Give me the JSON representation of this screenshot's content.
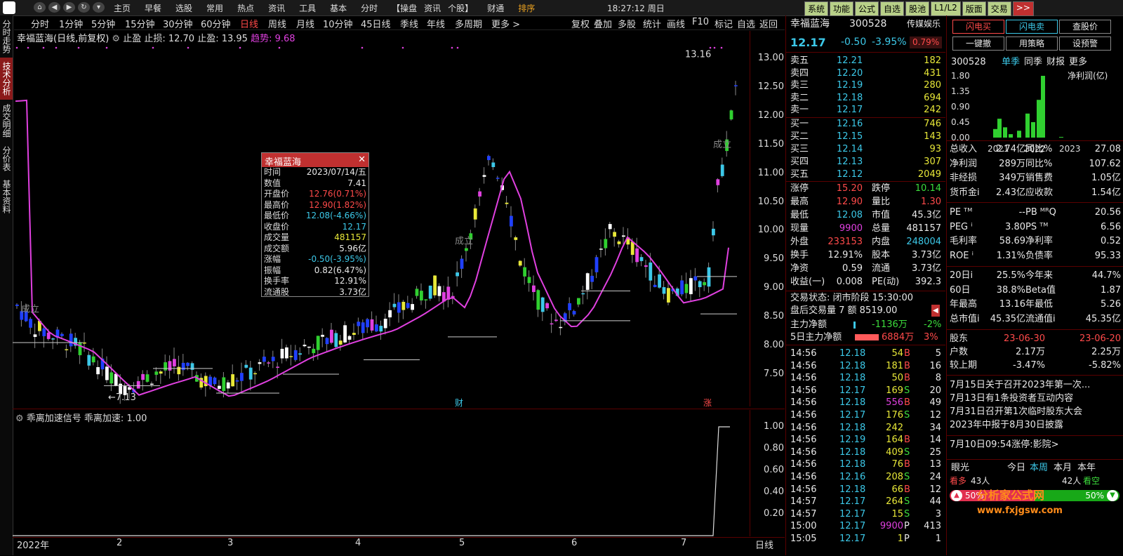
{
  "topbar": {
    "menu": [
      "主页",
      "早餐",
      "选股",
      "常用",
      "热点",
      "资讯",
      "工具",
      "基本",
      "分时",
      "【操盘",
      "资讯",
      "个股】",
      "财通",
      "排序"
    ],
    "clock": "18:27:12 周日",
    "right_buttons": [
      "系统",
      "功能",
      "公式",
      "自选",
      "股池",
      "L1/L2",
      "版面",
      "交易"
    ]
  },
  "leftrail": [
    "分时走势",
    "技术分析",
    "成交明细",
    "分价表",
    "基本资料"
  ],
  "periods": [
    "分时",
    "1分钟",
    "5分钟",
    "15分钟",
    "30分钟",
    "60分钟",
    "日线",
    "周线",
    "月线",
    "10分钟",
    "45日线",
    "季线",
    "年线",
    "多周期",
    "更多 >"
  ],
  "period_tools": [
    "复权",
    "叠加",
    "多股",
    "统计",
    "画线",
    "F10",
    "标记",
    "自选",
    "返回"
  ],
  "chart": {
    "title": "幸福蓝海(日线,前复权)",
    "stop_label": "止盈 止损: 12.70 止盈: 13.95",
    "trend_label": "趋势: 9.68",
    "price_ticks": [
      "13.00",
      "12.50",
      "12.00",
      "11.50",
      "11.00",
      "10.50",
      "10.00",
      "9.50",
      "9.00",
      "8.50",
      "8.00",
      "7.50"
    ],
    "high_label": "13.16",
    "low_label": "7.13",
    "chengli_label": "成立",
    "marker_cai": "财",
    "marker_zhang": "涨",
    "indicator_label": "乖离加速信号 乖离加速: 1.00",
    "ind_ticks": [
      "1.00",
      "0.80",
      "0.60",
      "0.40",
      "0.20"
    ],
    "x_labels": [
      "2022年",
      "2",
      "3",
      "4",
      "5",
      "6",
      "7"
    ],
    "x_period": "日线"
  },
  "popup": {
    "title": "幸福蓝海",
    "rows": [
      {
        "k": "时间",
        "v": "2023/07/14/五",
        "c": "white"
      },
      {
        "k": "数值",
        "v": "7.41",
        "c": "white"
      },
      {
        "k": "开盘价",
        "v": "12.76(0.71%)",
        "c": "red"
      },
      {
        "k": "最高价",
        "v": "12.90(1.82%)",
        "c": "red"
      },
      {
        "k": "最低价",
        "v": "12.08(-4.66%)",
        "c": "cyan"
      },
      {
        "k": "收盘价",
        "v": "12.17",
        "c": "cyan"
      },
      {
        "k": "成交量",
        "v": "481157",
        "c": "yellow"
      },
      {
        "k": "成交额",
        "v": "5.96亿",
        "c": "white"
      },
      {
        "k": "涨幅",
        "v": "-0.50(-3.95%)",
        "c": "cyan"
      },
      {
        "k": "振幅",
        "v": "0.82(6.47%)",
        "c": "white"
      },
      {
        "k": "换手率",
        "v": "12.91%",
        "c": "white"
      },
      {
        "k": "流通股",
        "v": "3.73亿",
        "c": "white"
      }
    ]
  },
  "quote": {
    "name": "幸福蓝海",
    "code": "300528",
    "sector": "传媒娱乐",
    "price": "12.17",
    "change": "-0.50",
    "pct": "-3.95%",
    "sector_pct": "0.79%",
    "asks": [
      {
        "k": "卖五",
        "p": "12.21",
        "v": "182"
      },
      {
        "k": "卖四",
        "p": "12.20",
        "v": "431"
      },
      {
        "k": "卖三",
        "p": "12.19",
        "v": "280"
      },
      {
        "k": "卖二",
        "p": "12.18",
        "v": "694"
      },
      {
        "k": "卖一",
        "p": "12.17",
        "v": "242"
      }
    ],
    "bids": [
      {
        "k": "买一",
        "p": "12.16",
        "v": "746"
      },
      {
        "k": "买二",
        "p": "12.15",
        "v": "143"
      },
      {
        "k": "买三",
        "p": "12.14",
        "v": "93"
      },
      {
        "k": "买四",
        "p": "12.13",
        "v": "307"
      },
      {
        "k": "买五",
        "p": "12.12",
        "v": "2049"
      }
    ],
    "stats": [
      {
        "k1": "涨停",
        "v1": "15.20",
        "c1": "red",
        "k2": "跌停",
        "v2": "10.14",
        "c2": "green"
      },
      {
        "k1": "最高",
        "v1": "12.90",
        "c1": "red",
        "k2": "量比",
        "v2": "1.30",
        "c2": "red"
      },
      {
        "k1": "最低",
        "v1": "12.08",
        "c1": "cyan",
        "k2": "市值",
        "v2": "45.3亿",
        "c2": "white"
      },
      {
        "k1": "现量",
        "v1": "9900",
        "c1": "mag",
        "k2": "总量",
        "v2": "481157",
        "c2": "white"
      },
      {
        "k1": "外盘",
        "v1": "233153",
        "c1": "red",
        "k2": "内盘",
        "v2": "248004",
        "c2": "cyan"
      },
      {
        "k1": "换手",
        "v1": "12.91%",
        "c1": "white",
        "k2": "股本",
        "v2": "3.73亿",
        "c2": "white"
      },
      {
        "k1": "净资",
        "v1": "0.59",
        "c1": "white",
        "k2": "流通",
        "v2": "3.73亿",
        "c2": "white"
      },
      {
        "k1": "收益(一)",
        "v1": "0.008",
        "c1": "white",
        "k2": "PE(动)",
        "v2": "392.3",
        "c2": "white"
      }
    ],
    "trade_status": "交易状态: 闭市阶段 15:30:00",
    "after_hours": "盘后交易量 7 额 8519.00",
    "main_flow_label": "主力净额",
    "main_flow": "-1136万",
    "main_flow_pct": "-2%",
    "main5_label": "5日主力净额",
    "main5": "6884万",
    "main5_pct": "3%",
    "ticks": [
      {
        "t": "14:56",
        "p": "12.18",
        "pc": "green",
        "v": "54",
        "vc": "yellow",
        "s": "B",
        "n": "5"
      },
      {
        "t": "14:56",
        "p": "12.18",
        "pc": "green",
        "v": "181",
        "vc": "yellow",
        "s": "B",
        "n": "16"
      },
      {
        "t": "14:56",
        "p": "12.18",
        "pc": "green",
        "v": "50",
        "vc": "yellow",
        "s": "B",
        "n": "8"
      },
      {
        "t": "14:56",
        "p": "12.17",
        "pc": "green",
        "v": "169",
        "vc": "yellow",
        "s": "S",
        "n": "20"
      },
      {
        "t": "14:56",
        "p": "12.18",
        "pc": "green",
        "v": "556",
        "vc": "mag",
        "s": "B",
        "n": "49"
      },
      {
        "t": "14:56",
        "p": "12.17",
        "pc": "green",
        "v": "176",
        "vc": "yellow",
        "s": "S",
        "n": "12"
      },
      {
        "t": "14:56",
        "p": "12.18",
        "pc": "green",
        "v": "242",
        "vc": "yellow",
        "s": "",
        "n": "34"
      },
      {
        "t": "14:56",
        "p": "12.19",
        "pc": "green",
        "v": "164",
        "vc": "yellow",
        "s": "B",
        "n": "14"
      },
      {
        "t": "14:56",
        "p": "12.18",
        "pc": "green",
        "v": "409",
        "vc": "yellow",
        "s": "S",
        "n": "25"
      },
      {
        "t": "14:56",
        "p": "12.18",
        "pc": "green",
        "v": "76",
        "vc": "yellow",
        "s": "B",
        "n": "13"
      },
      {
        "t": "14:56",
        "p": "12.16",
        "pc": "green",
        "v": "208",
        "vc": "yellow",
        "s": "S",
        "n": "24"
      },
      {
        "t": "14:56",
        "p": "12.18",
        "pc": "green",
        "v": "66",
        "vc": "yellow",
        "s": "B",
        "n": "12"
      },
      {
        "t": "14:57",
        "p": "12.17",
        "pc": "green",
        "v": "264",
        "vc": "yellow",
        "s": "S",
        "n": "44"
      },
      {
        "t": "14:57",
        "p": "12.17",
        "pc": "green",
        "v": "15",
        "vc": "yellow",
        "s": "S",
        "n": "3"
      },
      {
        "t": "15:00",
        "p": "12.17",
        "pc": "green",
        "v": "9900",
        "vc": "mag",
        "s": "P",
        "n": "413"
      },
      {
        "t": "15:05",
        "p": "12.17",
        "pc": "green",
        "v": "1",
        "vc": "yellow",
        "s": "P",
        "n": "1"
      }
    ]
  },
  "rp2": {
    "buttons": [
      "闪电买",
      "闪电卖",
      "查股价",
      "一键撤",
      "用策略",
      "设预警"
    ],
    "code": "300528",
    "tabs": [
      "单季",
      "同季",
      "财报",
      "更多"
    ],
    "fin_chart_title": "净利润(亿)",
    "fin_ticks": [
      "1.80",
      "1.35",
      "0.90",
      "0.45",
      "0.00"
    ],
    "fin_years": [
      "2021",
      "2022",
      "2023"
    ],
    "fin": [
      {
        "k1": "总收入",
        "v1": "2.74亿",
        "k2": "同比%",
        "v2": "27.08"
      },
      {
        "k1": "净利润",
        "v1": "289万",
        "k2": "同比%",
        "v2": "107.62"
      },
      {
        "k1": "非经损",
        "v1": "349万",
        "k2": "销售费",
        "v2": "1.05亿"
      },
      {
        "k1": "货币金i",
        "v1": "2.43亿",
        "k2": "应收款",
        "v2": "1.54亿"
      }
    ],
    "val": [
      {
        "k1": "PE ᵀᴹ",
        "v1": "--",
        "k2": "PB ᴹᴿQ",
        "v2": "20.56"
      },
      {
        "k1": "PEG ⁱ",
        "v1": "3.80",
        "k2": "PS ᵀᴹ",
        "v2": "6.56"
      },
      {
        "k1": "毛利率",
        "v1": "58.69",
        "k2": "净利率",
        "v2": "0.52"
      },
      {
        "k1": "ROE ⁱ",
        "v1": "1.31%",
        "k2": "负债率",
        "v2": "95.33"
      }
    ],
    "perf": [
      {
        "k1": "20日i",
        "v1": "25.5%",
        "k2": "今年来",
        "v2": "44.7%"
      },
      {
        "k1": "60日",
        "v1": "38.8%",
        "k2": "Beta值",
        "v2": "1.87"
      },
      {
        "k1": "年最高",
        "v1": "13.16",
        "k2": "年最低",
        "v2": "5.26"
      },
      {
        "k1": "总市值i",
        "v1": "45.35亿",
        "k2": "流通值i",
        "v2": "45.35亿"
      }
    ],
    "holders": {
      "label": "股东",
      "d1": "23-06-30",
      "d2": "23-06-20",
      "hk": "户数",
      "h1": "2.17万",
      "h2": "2.25万",
      "ck": "较上期",
      "c1": "-3.47%",
      "c2": "-5.82%"
    },
    "news": [
      "7月15日关于召开2023年第一次...",
      "7月13日有1条投资者互动内容",
      "7月31日召开第1次临时股东大会",
      "2023年中报于8月30日披露"
    ],
    "limit_news": "7月10日09:54涨停:影院>",
    "eye": {
      "label": "眼光",
      "tabs": [
        "今日",
        "本周",
        "本月",
        "本年"
      ],
      "bull": "看多",
      "bull_n": "43人",
      "bear_n": "42人",
      "bear": "看空",
      "bull_pct": "50%",
      "bear_pct": "50%"
    },
    "watermark": "分析家公式网 www.fxjgsw.com"
  }
}
